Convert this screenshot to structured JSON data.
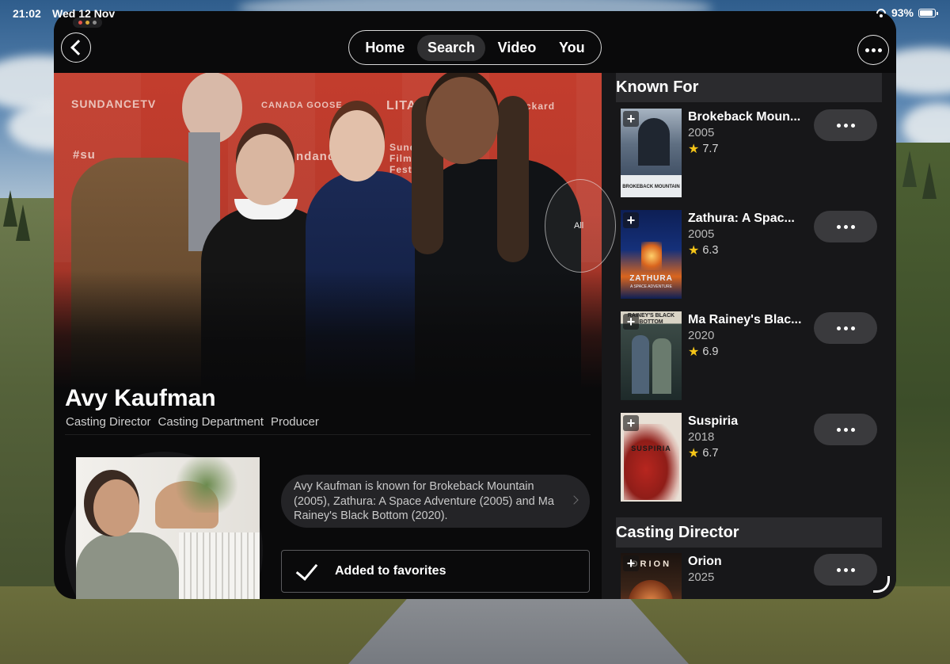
{
  "status_bar": {
    "time": "21:02",
    "date": "Wed 12 Nov",
    "battery": "93%",
    "battery_level": 0.93
  },
  "nav": {
    "tabs": [
      {
        "label": "Home"
      },
      {
        "label": "Search"
      },
      {
        "label": "Video"
      },
      {
        "label": "You"
      }
    ],
    "active_tab": "Search"
  },
  "hero": {
    "all_label": "All",
    "backdrop_text": [
      "SUNDANCETV",
      "CANADA GOOSE",
      "LITA",
      "t Packard",
      "#su",
      "ndance",
      "Sund Film Festi"
    ]
  },
  "person": {
    "name": "Avy Kaufman",
    "roles": [
      "Casting Director",
      "Casting Department",
      "Producer"
    ],
    "summary": "Avy Kaufman is known for Brokeback Mountain (2005), Zathura: A Space Adventure (2005) and Ma Rainey's Black Bottom (2020).",
    "favorite_label": "Added to favorites"
  },
  "known_for": {
    "header": "Known For",
    "items": [
      {
        "title": "Brokeback Moun...",
        "year": "2005",
        "rating": "7.7",
        "poster_text": "BROKEBACK MOUNTAIN",
        "poster_colors": [
          "#2d3c52",
          "#a7b4c2"
        ]
      },
      {
        "title": "Zathura: A Spac...",
        "year": "2005",
        "rating": "6.3",
        "poster_text": "ZATHURA",
        "poster_subtext": "A SPACE ADVENTURE",
        "poster_colors": [
          "#0d1f55",
          "#d9651e"
        ]
      },
      {
        "title": "Ma Rainey's Blac...",
        "year": "2020",
        "rating": "6.9",
        "poster_text": "RAINEY'S BLACK BOTTOM",
        "poster_colors": [
          "#1e2a2a",
          "#6a7b6e"
        ]
      },
      {
        "title": "Suspiria",
        "year": "2018",
        "rating": "6.7",
        "poster_text": "SUSPIRIA",
        "poster_colors": [
          "#e8e0d6",
          "#b7261f"
        ]
      }
    ]
  },
  "casting_director": {
    "header": "Casting Director",
    "items": [
      {
        "title": "Orion",
        "year": "2025",
        "poster_text": "ORION",
        "poster_colors": [
          "#1b130f",
          "#b8522a"
        ]
      }
    ]
  },
  "colors": {
    "window_bg": "#0a0a0b",
    "panel_bg": "#171719",
    "star": "#f5c518",
    "pill_bg": "#3a3a3d"
  }
}
